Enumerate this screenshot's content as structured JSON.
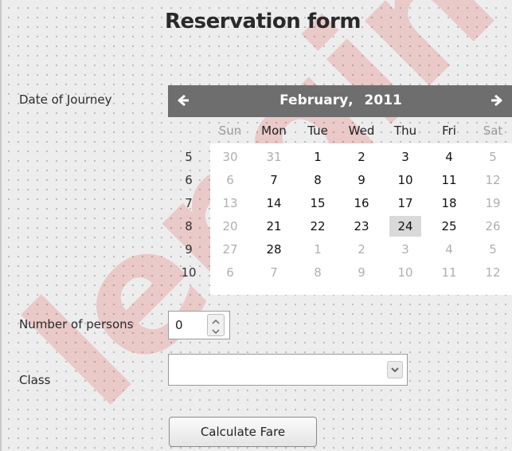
{
  "form": {
    "title": "Reservation form"
  },
  "labels": {
    "date_of_journey": "Date of Journey",
    "number_of_persons": "Number of persons",
    "class": "Class"
  },
  "calendar": {
    "month": "February",
    "separator": ",",
    "year": "2011",
    "weekdays": [
      "Sun",
      "Mon",
      "Tue",
      "Wed",
      "Thu",
      "Fri",
      "Sat"
    ],
    "weeks": [
      {
        "number": "5",
        "days": [
          "30",
          "31",
          "1",
          "2",
          "3",
          "4",
          "5"
        ]
      },
      {
        "number": "6",
        "days": [
          "6",
          "7",
          "8",
          "9",
          "10",
          "11",
          "12"
        ]
      },
      {
        "number": "7",
        "days": [
          "13",
          "14",
          "15",
          "16",
          "17",
          "18",
          "19"
        ]
      },
      {
        "number": "8",
        "days": [
          "20",
          "21",
          "22",
          "23",
          "24",
          "25",
          "26"
        ]
      },
      {
        "number": "9",
        "days": [
          "27",
          "28",
          "1",
          "2",
          "3",
          "4",
          "5"
        ]
      },
      {
        "number": "10",
        "days": [
          "6",
          "7",
          "8",
          "9",
          "10",
          "11",
          "12"
        ]
      }
    ],
    "selected_day": "24",
    "prev_icon": "arrow-left-icon",
    "next_icon": "arrow-right-icon",
    "header_color": "#6e6e6e",
    "selected_color": "#d9d9d9"
  },
  "persons": {
    "value": "0"
  },
  "class_select": {
    "value": ""
  },
  "buttons": {
    "calculate": "Calculate Fare"
  },
  "watermark": {
    "text": "lengine",
    "color": "#dc0000"
  }
}
